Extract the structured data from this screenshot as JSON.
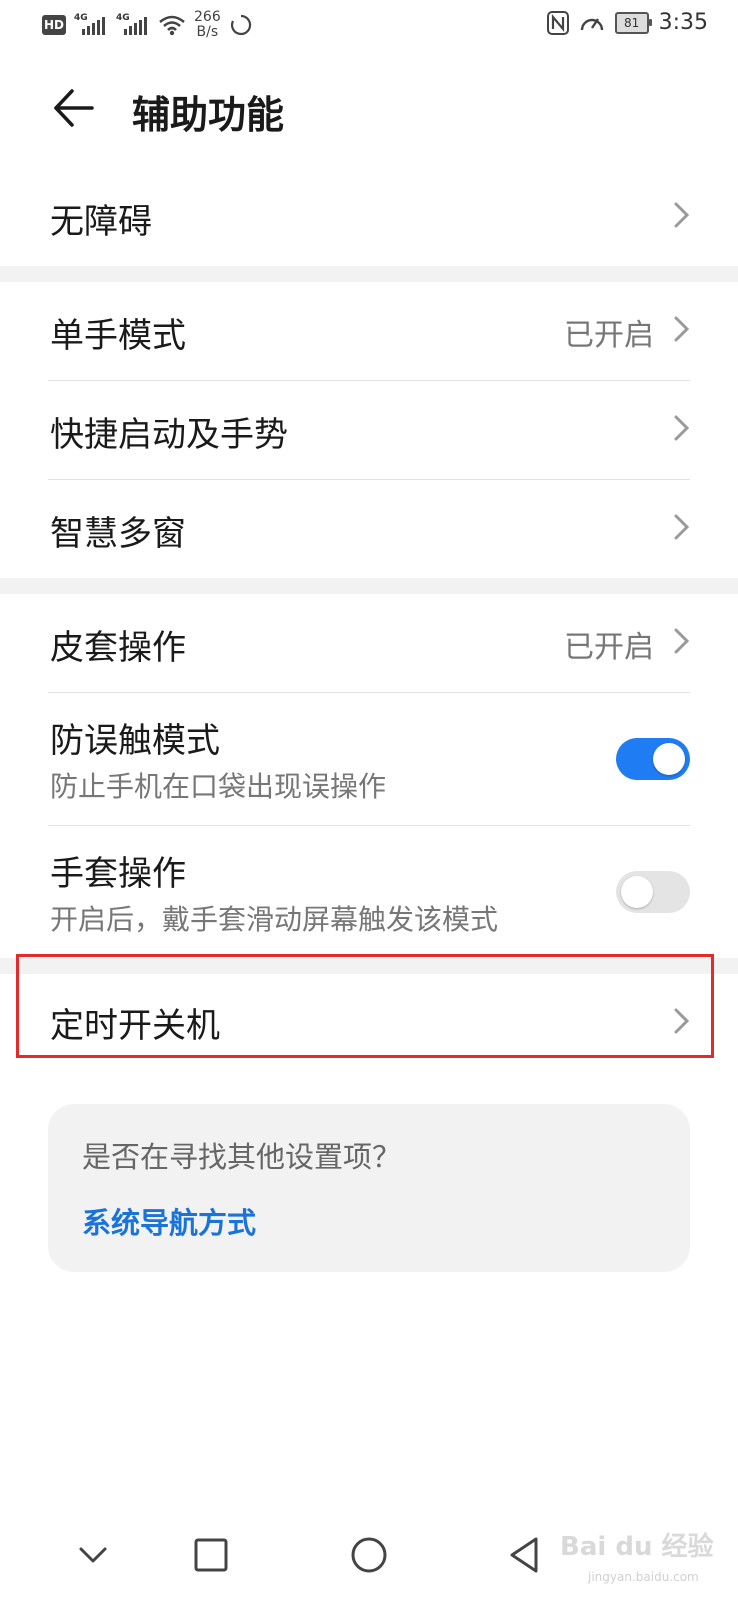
{
  "status_bar": {
    "hd": "HD",
    "sim1": "4G",
    "sim2": "4G",
    "speed_value": "266",
    "speed_unit": "B/s",
    "battery": "81",
    "time": "3:35"
  },
  "header": {
    "title": "辅助功能"
  },
  "items": {
    "accessibility": {
      "label": "无障碍"
    },
    "one_hand": {
      "label": "单手模式",
      "value": "已开启"
    },
    "quick_start": {
      "label": "快捷启动及手势"
    },
    "smart_multiwindow": {
      "label": "智慧多窗"
    },
    "cover": {
      "label": "皮套操作",
      "value": "已开启"
    },
    "pocket_mode": {
      "label": "防误触模式",
      "sub": "防止手机在口袋出现误操作",
      "enabled": true
    },
    "glove_mode": {
      "label": "手套操作",
      "sub": "开启后，戴手套滑动屏幕触发该模式",
      "enabled": false
    },
    "scheduled_power": {
      "label": "定时开关机"
    }
  },
  "tip": {
    "question": "是否在寻找其他设置项？",
    "link": "系统导航方式"
  },
  "watermark": {
    "brand": "Bai du 经验",
    "url": "jingyan.baidu.com"
  },
  "colors": {
    "accent": "#1f7cf2",
    "link": "#1a73d9",
    "highlight": "#e32b2b"
  }
}
